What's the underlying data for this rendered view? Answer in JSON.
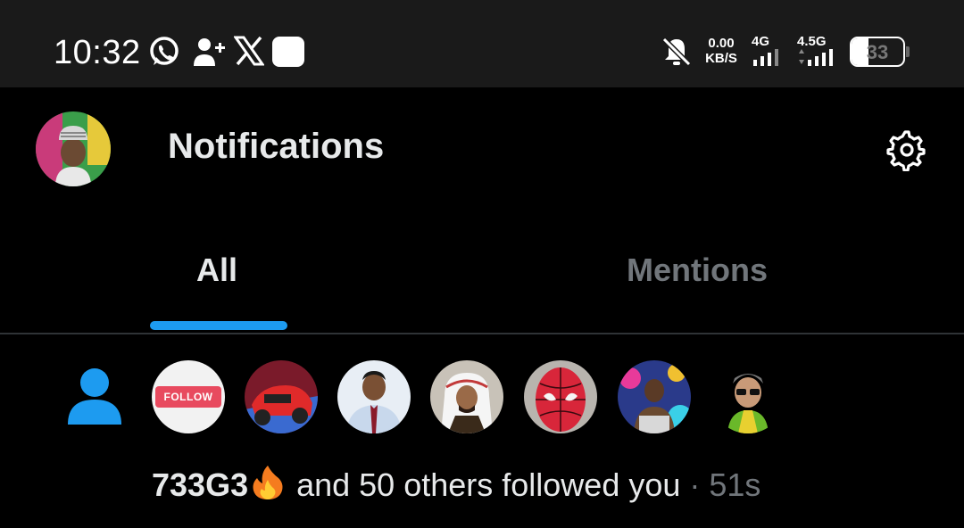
{
  "status_bar": {
    "time": "10:32",
    "net_speed_value": "0.00",
    "net_speed_unit": "KB/S",
    "network1": "4G",
    "network2": "4.5G",
    "battery_percent": "33",
    "battery_level": 0.33
  },
  "header": {
    "title": "Notifications"
  },
  "tabs": [
    {
      "label": "All",
      "active": true
    },
    {
      "label": "Mentions",
      "active": false
    }
  ],
  "notification": {
    "follow_badge_text": "FOLLOW",
    "name": "733G3",
    "emoji": "fire",
    "text": " and 50 others followed you",
    "separator": " · ",
    "time": "51s",
    "follower_avatar_count": 7
  },
  "colors": {
    "accent": "#1d9bf0",
    "background": "#000000",
    "status_bar": "#1a1a1a",
    "muted_text": "#71767b"
  }
}
